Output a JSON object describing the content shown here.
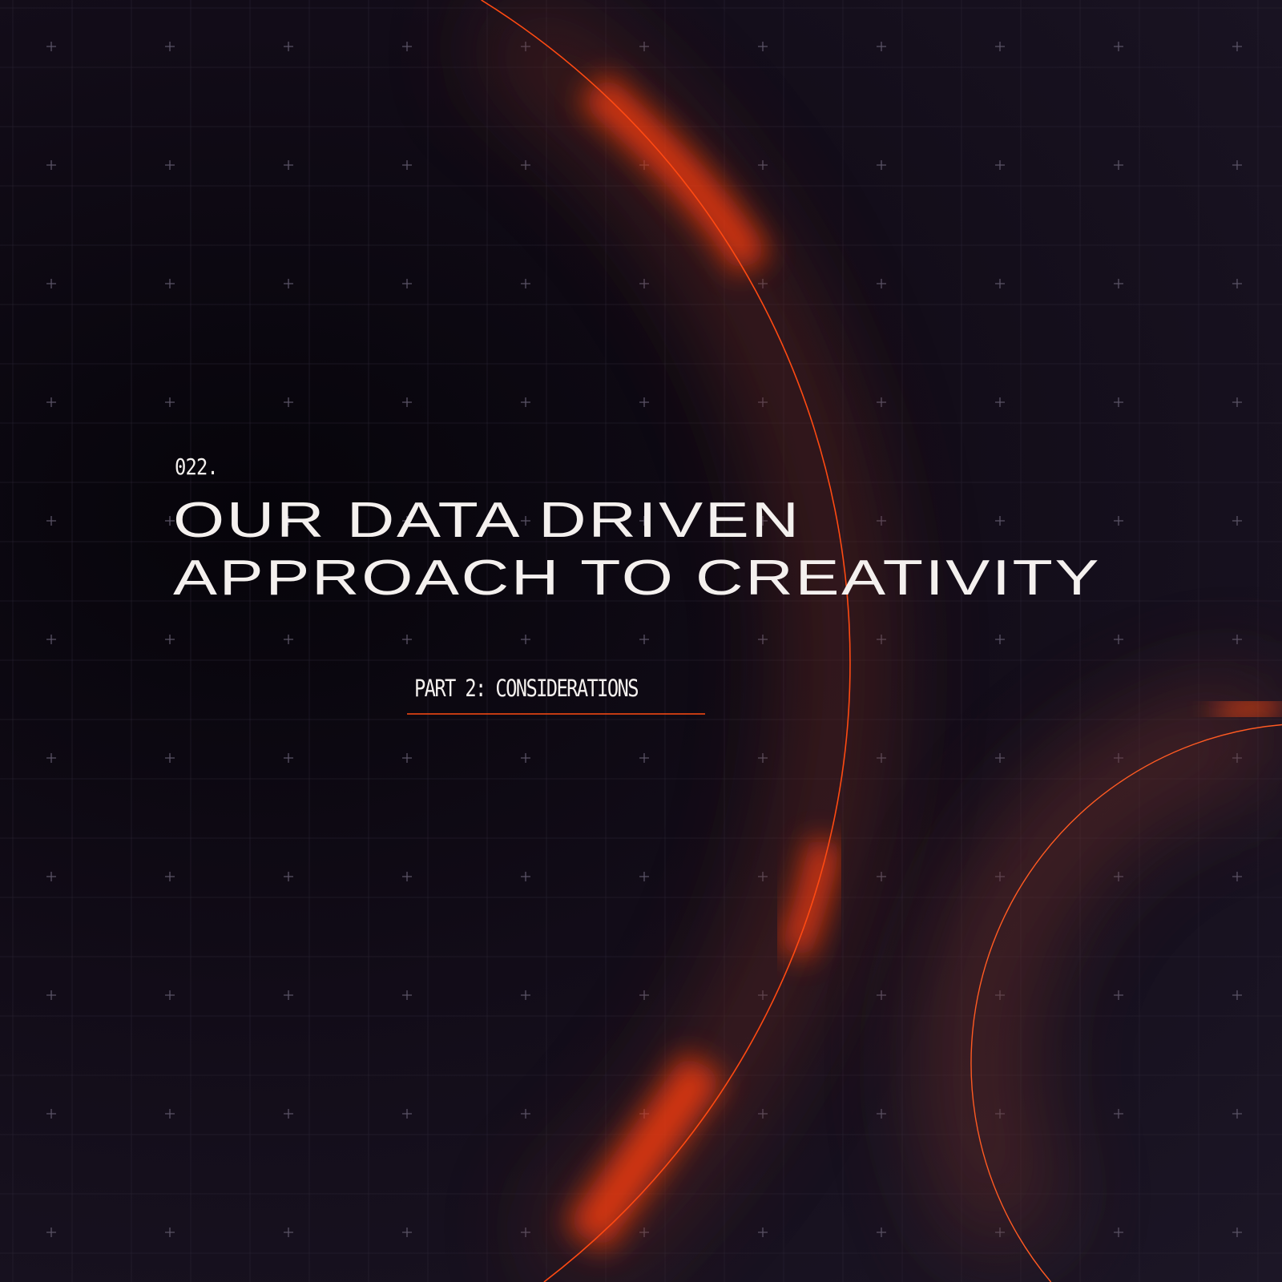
{
  "slide": {
    "index": "022.",
    "title_line1": "OUR DATA DRIVEN",
    "title_line2": "APPROACH TO CREATIVITY",
    "subtitle": "PART 2: CONSIDERATIONS"
  },
  "colors": {
    "accent": "#ff4a12",
    "background": "#0b0810",
    "text": "#f4f0ee",
    "grid": "#2e2838"
  }
}
